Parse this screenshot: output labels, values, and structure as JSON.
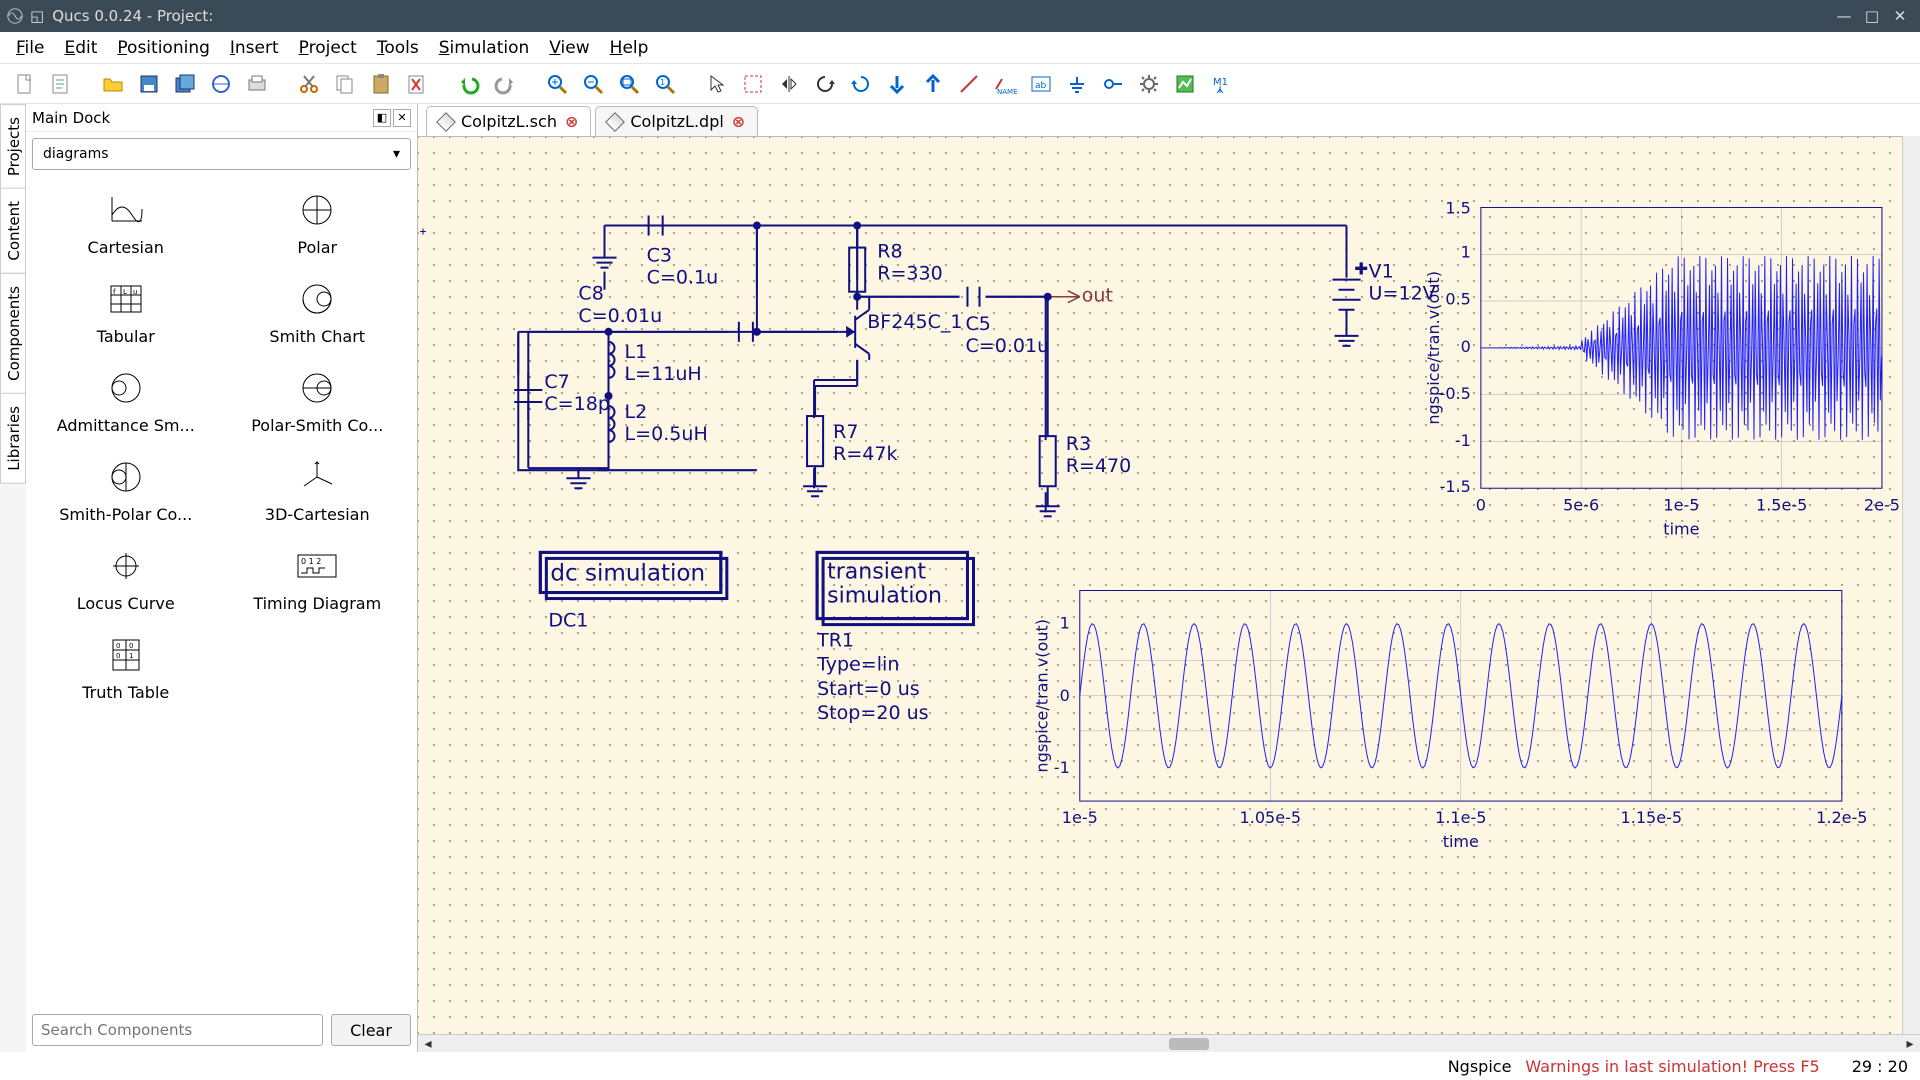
{
  "window": {
    "title": "Qucs 0.0.24 - Project:"
  },
  "menu": {
    "items": [
      {
        "label": "File",
        "accel": "F"
      },
      {
        "label": "Edit",
        "accel": "E"
      },
      {
        "label": "Positioning",
        "accel": "P"
      },
      {
        "label": "Insert",
        "accel": "I"
      },
      {
        "label": "Project",
        "accel": "P"
      },
      {
        "label": "Tools",
        "accel": "T"
      },
      {
        "label": "Simulation",
        "accel": "S"
      },
      {
        "label": "View",
        "accel": "V"
      },
      {
        "label": "Help",
        "accel": "H"
      }
    ]
  },
  "toolbar": [
    "new-file",
    "new-text",
    "",
    "open",
    "save",
    "save-all",
    "print",
    "print-preview",
    "",
    "cut",
    "copy",
    "paste",
    "delete",
    "",
    "undo",
    "redo",
    "",
    "zoom-in",
    "zoom-out",
    "zoom-fit",
    "zoom-1",
    "",
    "pointer",
    "select-rect",
    "mirror",
    "rotate",
    "rotate-ccw",
    "move-down",
    "move-up",
    "wire",
    "name-label",
    "text-box",
    "ground",
    "port",
    "gear",
    "chart",
    "marker"
  ],
  "dock": {
    "title": "Main Dock",
    "vtabs": [
      "Projects",
      "Content",
      "Components",
      "Libraries"
    ],
    "active_vtab": 2,
    "category": "diagrams",
    "search_placeholder": "Search Components",
    "clear_label": "Clear",
    "items": [
      {
        "label": "Cartesian",
        "icon": "cartesian"
      },
      {
        "label": "Polar",
        "icon": "polar"
      },
      {
        "label": "Tabular",
        "icon": "tabular"
      },
      {
        "label": "Smith Chart",
        "icon": "smith"
      },
      {
        "label": "Admittance Sm...",
        "icon": "admittance-smith"
      },
      {
        "label": "Polar-Smith Co...",
        "icon": "polar-smith"
      },
      {
        "label": "Smith-Polar Co...",
        "icon": "smith-polar"
      },
      {
        "label": "3D-Cartesian",
        "icon": "axes3d"
      },
      {
        "label": "Locus Curve",
        "icon": "locus"
      },
      {
        "label": "Timing Diagram",
        "icon": "timing"
      },
      {
        "label": "Truth Table",
        "icon": "truth-table"
      }
    ]
  },
  "tabs": [
    {
      "label": "ColpitzL.sch",
      "active": true
    },
    {
      "label": "ColpitzL.dpl",
      "active": false
    }
  ],
  "schematic": {
    "components": {
      "C3": {
        "name": "C3",
        "val": "C=0.1u"
      },
      "C8": {
        "name": "C8",
        "val": "C=0.01u"
      },
      "C7": {
        "name": "C7",
        "val": "C=18p"
      },
      "C5": {
        "name": "C5",
        "val": "C=0.01u"
      },
      "L1": {
        "name": "L1",
        "val": "L=11uH"
      },
      "L2": {
        "name": "L2",
        "val": "L=0.5uH"
      },
      "R8": {
        "name": "R8",
        "val": "R=330"
      },
      "R7": {
        "name": "R7",
        "val": "R=47k"
      },
      "R3": {
        "name": "R3",
        "val": "R=470"
      },
      "V1": {
        "name": "V1",
        "val": "U=12V"
      },
      "Q1": {
        "name": "BF245C_1"
      },
      "out": "out"
    },
    "dc_sim": {
      "title": "dc simulation",
      "name": "DC1"
    },
    "tr_sim": {
      "title": "transient simulation",
      "name": "TR1",
      "p1": "Type=lin",
      "p2": "Start=0 us",
      "p3": "Stop=20 us"
    },
    "plot1": {
      "ylabel": "ngspice/tran.v(out)",
      "xlabel": "time",
      "yticks": [
        "-1.5",
        "-1",
        "-0.5",
        "0",
        "0.5",
        "1",
        "1.5"
      ],
      "xticks": [
        "0",
        "5e-6",
        "1e-5",
        "1.5e-5",
        "2e-5"
      ]
    },
    "plot2": {
      "ylabel": "ngspice/tran.v(out)",
      "xlabel": "time",
      "yticks": [
        "-1",
        "0",
        "1"
      ],
      "xticks": [
        "1e-5",
        "1.05e-5",
        "1.1e-5",
        "1.15e-5",
        "1.2e-5"
      ]
    }
  },
  "status": {
    "engine": "Ngspice",
    "warning": "Warnings in last simulation! Press F5",
    "cursor": "29 : 20"
  }
}
